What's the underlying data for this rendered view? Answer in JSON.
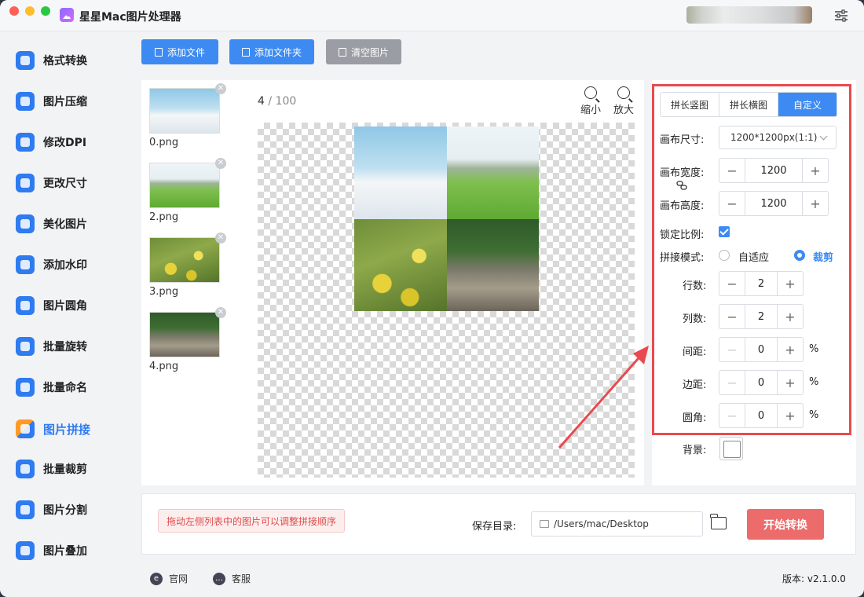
{
  "app": {
    "title": "星星Mac图片处理器"
  },
  "sidebar": {
    "items": [
      {
        "label": "格式转换"
      },
      {
        "label": "图片压缩"
      },
      {
        "label": "修改DPI"
      },
      {
        "label": "更改尺寸"
      },
      {
        "label": "美化图片"
      },
      {
        "label": "添加水印"
      },
      {
        "label": "图片圆角"
      },
      {
        "label": "批量旋转"
      },
      {
        "label": "批量命名"
      },
      {
        "label": "图片拼接",
        "active": true
      },
      {
        "label": "批量裁剪"
      },
      {
        "label": "图片分割"
      },
      {
        "label": "图片叠加"
      }
    ]
  },
  "toolbar": {
    "add_file": "添加文件",
    "add_folder": "添加文件夹",
    "clear": "清空图片"
  },
  "files": [
    {
      "name": "0.png"
    },
    {
      "name": "2.png"
    },
    {
      "name": "3.png"
    },
    {
      "name": "4.png"
    }
  ],
  "preview": {
    "count": "4",
    "separator": "/",
    "total": "100",
    "zoom_out": "缩小",
    "zoom_in": "放大"
  },
  "settings": {
    "tabs": [
      "拼长竖图",
      "拼长横图",
      "自定义"
    ],
    "active_tab": "自定义",
    "canvas_size_label": "画布尺寸:",
    "canvas_size_value": "1200*1200px(1:1)",
    "canvas_width_label": "画布宽度:",
    "canvas_width": "1200",
    "canvas_height_label": "画布高度:",
    "canvas_height": "1200",
    "lock_ratio_label": "锁定比例:",
    "lock_ratio": true,
    "mode_label": "拼接模式:",
    "mode_options": [
      "自适应",
      "裁剪"
    ],
    "mode_selected": "裁剪",
    "rows_label": "行数:",
    "rows": "2",
    "cols_label": "列数:",
    "cols": "2",
    "spacing_label": "间距:",
    "spacing": "0",
    "margin_label": "边距:",
    "margin": "0",
    "radius_label": "圆角:",
    "radius": "0",
    "percent": "%",
    "background_label": "背景:",
    "minus": "−",
    "plus": "+"
  },
  "bottom": {
    "hint": "拖动左侧列表中的图片可以调整拼接顺序",
    "save_label": "保存目录:",
    "save_path": "/Users/mac/Desktop",
    "start": "开始转换"
  },
  "footer": {
    "website": "官网",
    "support": "客服",
    "version": "版本: v2.1.0.0"
  },
  "colors": {
    "accent": "#3d8bf2",
    "start_button": "#ec6b6b",
    "highlight_box": "#e84a4f"
  }
}
